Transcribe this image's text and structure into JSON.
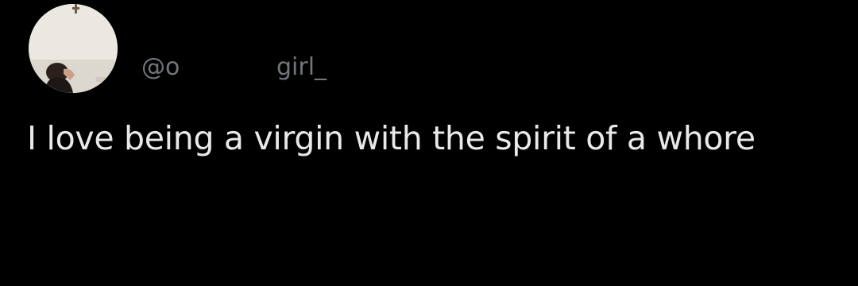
{
  "author": {
    "avatar_icon": "profile-photo",
    "handle_prefix": "@o",
    "handle_suffix": "girl_"
  },
  "tweet": {
    "text": "I love being a virgin with the spirit of a whore"
  },
  "colors": {
    "background": "#000000",
    "handle": "#71767b",
    "text": "#e7e9ea"
  }
}
